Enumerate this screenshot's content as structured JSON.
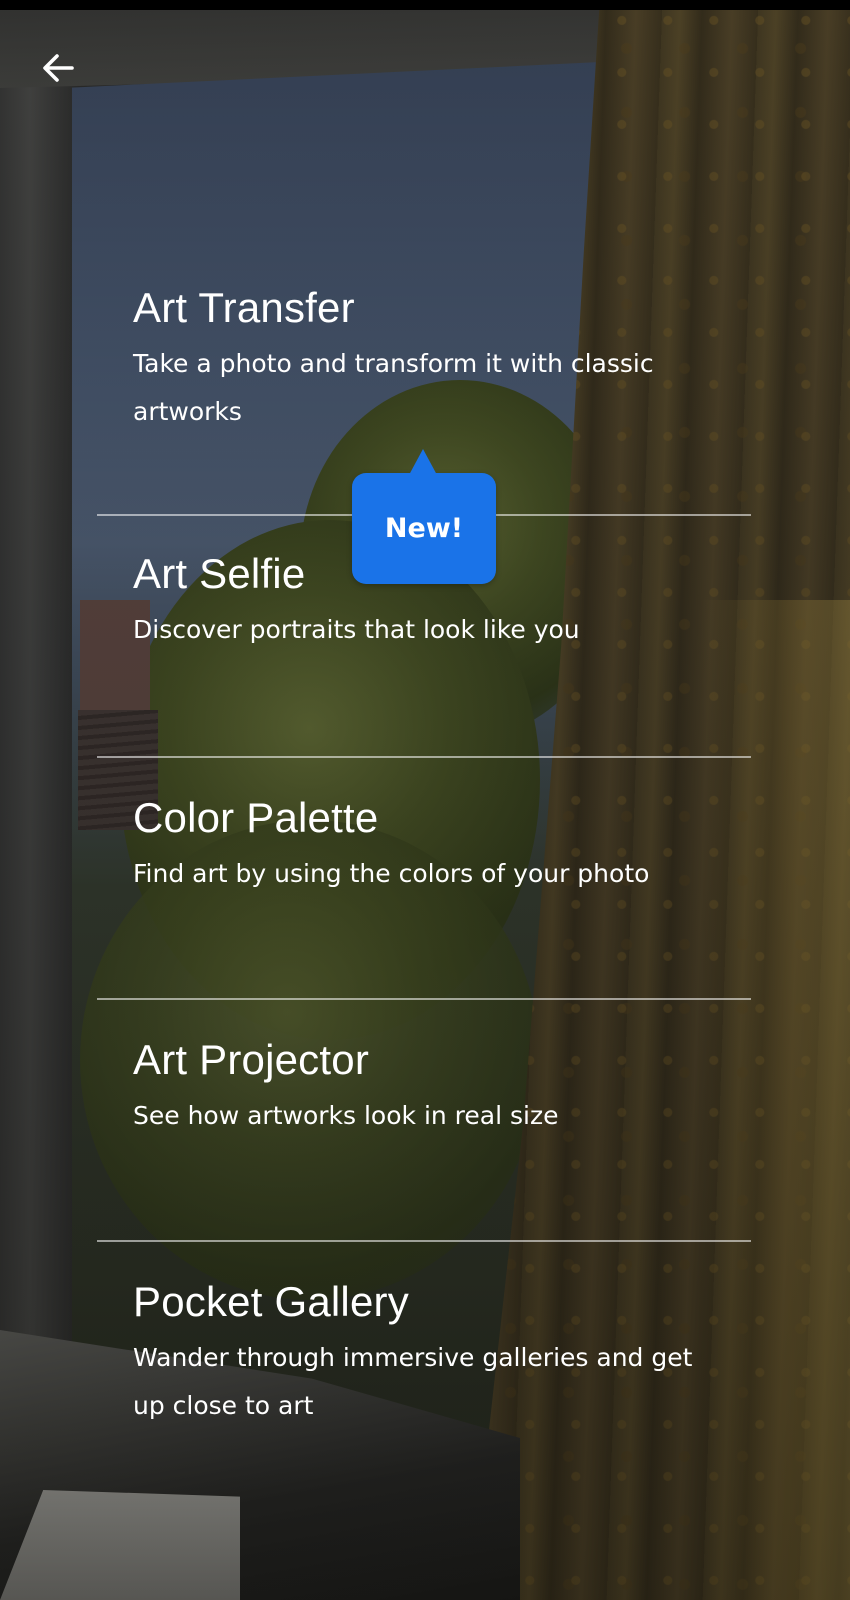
{
  "header": {
    "back_icon": "arrow-back-icon"
  },
  "menu": {
    "items": [
      {
        "title": "Art Transfer",
        "description": "Take a photo and transform it with classic artworks"
      },
      {
        "title": "Art Selfie",
        "description": "Discover portraits that look like you"
      },
      {
        "title": "Color Palette",
        "description": "Find art by using the colors of your photo"
      },
      {
        "title": "Art Projector",
        "description": "See how artworks look in real size"
      },
      {
        "title": "Pocket Gallery",
        "description": "Wander through immersive galleries and get up close to art"
      }
    ]
  },
  "tooltip": {
    "label": "New!",
    "color": "#1a73e8"
  }
}
